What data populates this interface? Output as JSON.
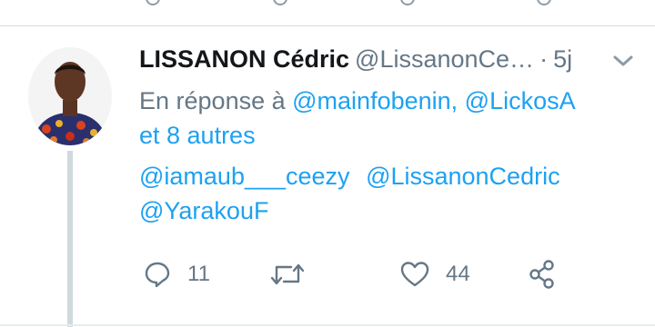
{
  "tweet": {
    "author_name": "LISSANON Cédric",
    "author_handle": "@LissanonCe…",
    "separator": "·",
    "time": "5j",
    "reply_to": {
      "prefix": "En réponse à",
      "mention_1": "@mainfobenin,",
      "mention_2": "@LickosA",
      "others": "et 8 autres"
    },
    "body_mentions": [
      "@iamaub___ceezy",
      "@LissanonCedric",
      "@YarakouF"
    ],
    "actions": {
      "reply_count": "11",
      "retweet_count": "",
      "like_count": "44"
    }
  },
  "icons": [
    "caret-down-icon",
    "reply-icon",
    "retweet-icon",
    "like-icon",
    "share-icon"
  ],
  "colors": {
    "link": "#1da1f2",
    "muted": "#657786",
    "text": "#14171a",
    "thread_line": "#cfd9de"
  }
}
